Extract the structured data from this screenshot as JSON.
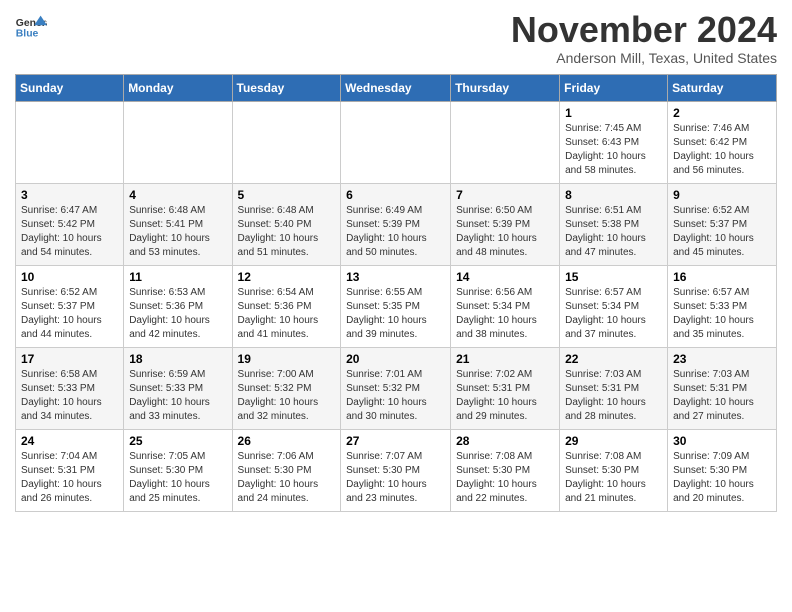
{
  "header": {
    "logo_line1": "General",
    "logo_line2": "Blue",
    "month": "November 2024",
    "location": "Anderson Mill, Texas, United States"
  },
  "days_of_week": [
    "Sunday",
    "Monday",
    "Tuesday",
    "Wednesday",
    "Thursday",
    "Friday",
    "Saturday"
  ],
  "weeks": [
    [
      {
        "day": "",
        "info": ""
      },
      {
        "day": "",
        "info": ""
      },
      {
        "day": "",
        "info": ""
      },
      {
        "day": "",
        "info": ""
      },
      {
        "day": "",
        "info": ""
      },
      {
        "day": "1",
        "info": "Sunrise: 7:45 AM\nSunset: 6:43 PM\nDaylight: 10 hours and 58 minutes."
      },
      {
        "day": "2",
        "info": "Sunrise: 7:46 AM\nSunset: 6:42 PM\nDaylight: 10 hours and 56 minutes."
      }
    ],
    [
      {
        "day": "3",
        "info": "Sunrise: 6:47 AM\nSunset: 5:42 PM\nDaylight: 10 hours and 54 minutes."
      },
      {
        "day": "4",
        "info": "Sunrise: 6:48 AM\nSunset: 5:41 PM\nDaylight: 10 hours and 53 minutes."
      },
      {
        "day": "5",
        "info": "Sunrise: 6:48 AM\nSunset: 5:40 PM\nDaylight: 10 hours and 51 minutes."
      },
      {
        "day": "6",
        "info": "Sunrise: 6:49 AM\nSunset: 5:39 PM\nDaylight: 10 hours and 50 minutes."
      },
      {
        "day": "7",
        "info": "Sunrise: 6:50 AM\nSunset: 5:39 PM\nDaylight: 10 hours and 48 minutes."
      },
      {
        "day": "8",
        "info": "Sunrise: 6:51 AM\nSunset: 5:38 PM\nDaylight: 10 hours and 47 minutes."
      },
      {
        "day": "9",
        "info": "Sunrise: 6:52 AM\nSunset: 5:37 PM\nDaylight: 10 hours and 45 minutes."
      }
    ],
    [
      {
        "day": "10",
        "info": "Sunrise: 6:52 AM\nSunset: 5:37 PM\nDaylight: 10 hours and 44 minutes."
      },
      {
        "day": "11",
        "info": "Sunrise: 6:53 AM\nSunset: 5:36 PM\nDaylight: 10 hours and 42 minutes."
      },
      {
        "day": "12",
        "info": "Sunrise: 6:54 AM\nSunset: 5:36 PM\nDaylight: 10 hours and 41 minutes."
      },
      {
        "day": "13",
        "info": "Sunrise: 6:55 AM\nSunset: 5:35 PM\nDaylight: 10 hours and 39 minutes."
      },
      {
        "day": "14",
        "info": "Sunrise: 6:56 AM\nSunset: 5:34 PM\nDaylight: 10 hours and 38 minutes."
      },
      {
        "day": "15",
        "info": "Sunrise: 6:57 AM\nSunset: 5:34 PM\nDaylight: 10 hours and 37 minutes."
      },
      {
        "day": "16",
        "info": "Sunrise: 6:57 AM\nSunset: 5:33 PM\nDaylight: 10 hours and 35 minutes."
      }
    ],
    [
      {
        "day": "17",
        "info": "Sunrise: 6:58 AM\nSunset: 5:33 PM\nDaylight: 10 hours and 34 minutes."
      },
      {
        "day": "18",
        "info": "Sunrise: 6:59 AM\nSunset: 5:33 PM\nDaylight: 10 hours and 33 minutes."
      },
      {
        "day": "19",
        "info": "Sunrise: 7:00 AM\nSunset: 5:32 PM\nDaylight: 10 hours and 32 minutes."
      },
      {
        "day": "20",
        "info": "Sunrise: 7:01 AM\nSunset: 5:32 PM\nDaylight: 10 hours and 30 minutes."
      },
      {
        "day": "21",
        "info": "Sunrise: 7:02 AM\nSunset: 5:31 PM\nDaylight: 10 hours and 29 minutes."
      },
      {
        "day": "22",
        "info": "Sunrise: 7:03 AM\nSunset: 5:31 PM\nDaylight: 10 hours and 28 minutes."
      },
      {
        "day": "23",
        "info": "Sunrise: 7:03 AM\nSunset: 5:31 PM\nDaylight: 10 hours and 27 minutes."
      }
    ],
    [
      {
        "day": "24",
        "info": "Sunrise: 7:04 AM\nSunset: 5:31 PM\nDaylight: 10 hours and 26 minutes."
      },
      {
        "day": "25",
        "info": "Sunrise: 7:05 AM\nSunset: 5:30 PM\nDaylight: 10 hours and 25 minutes."
      },
      {
        "day": "26",
        "info": "Sunrise: 7:06 AM\nSunset: 5:30 PM\nDaylight: 10 hours and 24 minutes."
      },
      {
        "day": "27",
        "info": "Sunrise: 7:07 AM\nSunset: 5:30 PM\nDaylight: 10 hours and 23 minutes."
      },
      {
        "day": "28",
        "info": "Sunrise: 7:08 AM\nSunset: 5:30 PM\nDaylight: 10 hours and 22 minutes."
      },
      {
        "day": "29",
        "info": "Sunrise: 7:08 AM\nSunset: 5:30 PM\nDaylight: 10 hours and 21 minutes."
      },
      {
        "day": "30",
        "info": "Sunrise: 7:09 AM\nSunset: 5:30 PM\nDaylight: 10 hours and 20 minutes."
      }
    ]
  ]
}
